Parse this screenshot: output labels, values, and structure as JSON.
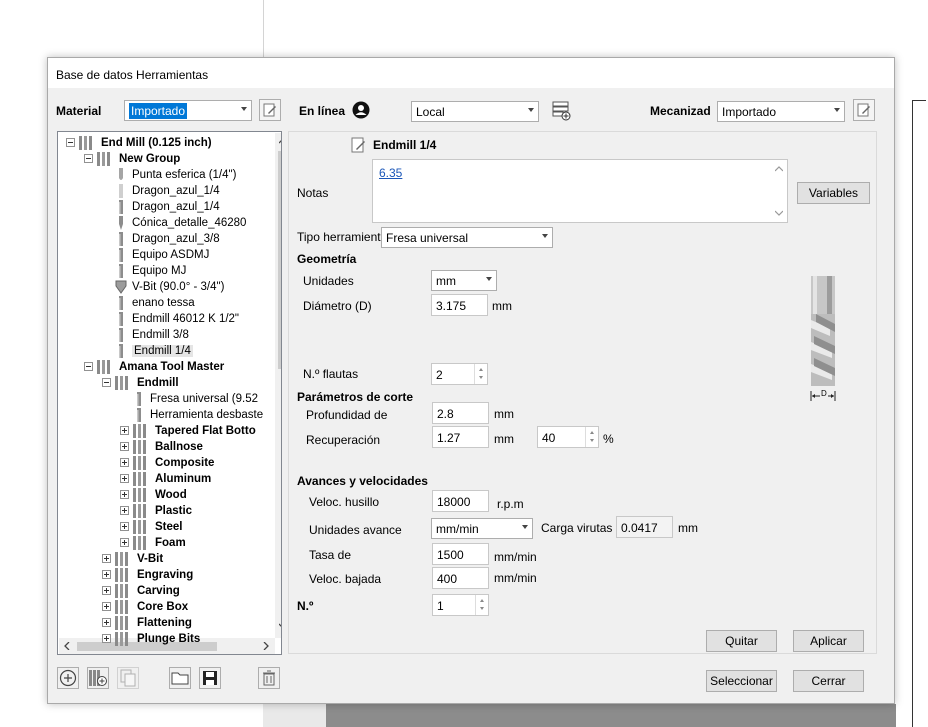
{
  "dialog": {
    "title": "Base de datos Herramientas"
  },
  "header": {
    "material_label": "Material",
    "material_value": "Importado",
    "online_label": "En línea",
    "location_value": "Local",
    "machining_label": "Mecanizad",
    "machining_value": "Importado"
  },
  "tree": {
    "rows": [
      {
        "label": "End Mill (0.125 inch)",
        "bold": true
      },
      {
        "label": "New Group",
        "bold": true
      },
      {
        "label": "Punta esferica (1/4\")"
      },
      {
        "label": "Dragon_azul_1/4"
      },
      {
        "label": "Dragon_azul_1/4"
      },
      {
        "label": "Cónica_detalle_46280"
      },
      {
        "label": "Dragon_azul_3/8"
      },
      {
        "label": "Equipo ASDMJ"
      },
      {
        "label": "Equipo MJ"
      },
      {
        "label": "V-Bit (90.0° - 3/4\")"
      },
      {
        "label": "enano tessa"
      },
      {
        "label": "Endmill 46012 K 1/2\""
      },
      {
        "label": "Endmill 3/8"
      },
      {
        "label": "Endmill 1/4",
        "selected": true
      },
      {
        "label": "Amana Tool Master",
        "bold": true
      },
      {
        "label": "Endmill",
        "bold": true
      },
      {
        "label": "Fresa universal (9.52"
      },
      {
        "label": "Herramienta desbaste"
      },
      {
        "label": "Tapered Flat Botto",
        "bold": true
      },
      {
        "label": "Ballnose",
        "bold": true
      },
      {
        "label": "Composite",
        "bold": true
      },
      {
        "label": "Aluminum",
        "bold": true
      },
      {
        "label": "Wood",
        "bold": true
      },
      {
        "label": "Plastic",
        "bold": true
      },
      {
        "label": "Steel",
        "bold": true
      },
      {
        "label": "Foam",
        "bold": true
      },
      {
        "label": "V-Bit",
        "bold": true
      },
      {
        "label": "Engraving",
        "bold": true
      },
      {
        "label": "Carving",
        "bold": true
      },
      {
        "label": "Core Box",
        "bold": true
      },
      {
        "label": "Flattening",
        "bold": true
      },
      {
        "label": "Plunge Bits",
        "bold": true
      }
    ]
  },
  "tool": {
    "name": "Endmill 1/4",
    "notes_label": "Notas",
    "notes_value": "6.35",
    "variables_button": "Variables",
    "type_label": "Tipo herramienta",
    "type_value": "Fresa universal",
    "geometry_heading": "Geometría",
    "units_label": "Unidades",
    "units_value": "mm",
    "diameter_label": "Diámetro (D)",
    "diameter_value": "3.175",
    "diameter_unit": "mm",
    "flutes_label": "N.º flautas",
    "flutes_value": "2",
    "image_label": "D",
    "cutting_heading": "Parámetros de corte",
    "depth_label": "Profundidad de",
    "depth_value": "2.8",
    "depth_unit": "mm",
    "stepover_label": "Recuperación",
    "stepover_value": "1.27",
    "stepover_unit": "mm",
    "stepover_percent": "40",
    "percent_sign": "%",
    "feeds_heading": "Avances y velocidades",
    "spindle_label": "Veloc. husillo",
    "spindle_value": "18000",
    "spindle_unit": "r.p.m",
    "feed_units_label": "Unidades avance",
    "feed_units_value": "mm/min",
    "chipload_label": "Carga virutas",
    "chipload_value": "0.0417",
    "chipload_unit": "mm",
    "feed_rate_label": "Tasa de",
    "feed_rate_value": "1500",
    "feed_rate_unit": "mm/min",
    "plunge_label": "Veloc. bajada",
    "plunge_value": "400",
    "plunge_unit": "mm/min",
    "number_label": "N.º",
    "number_value": "1",
    "remove_button": "Quitar",
    "apply_button": "Aplicar"
  },
  "footer": {
    "select_button": "Seleccionar",
    "close_button": "Cerrar"
  },
  "icons": [
    "edit-icon",
    "account-icon",
    "database-settings-icon",
    "add-icon",
    "add-tool-icon",
    "copy-icon",
    "folder-icon",
    "save-icon",
    "trash-icon"
  ]
}
